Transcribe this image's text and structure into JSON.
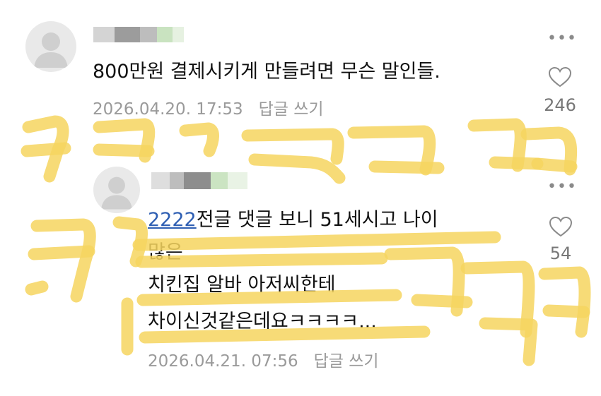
{
  "comments": [
    {
      "text": "800만원 결제시키게 만들려면 무슨 말인들.",
      "date": "2026.04.20. 17:53",
      "reply_label": "답글 쓰기",
      "likes": "246",
      "more": "•••"
    },
    {
      "mention": "2222",
      "lines": [
        "전글 댓글 보니 51세시고 나이",
        "많은",
        "치킨집 알바 아저씨한테",
        "차이신것같은데요ㅋㅋㅋㅋ..."
      ],
      "date": "2026.04.21. 07:56",
      "reply_label": "답글 쓰기",
      "likes": "54",
      "more": "•••"
    }
  ],
  "icons": {
    "avatar": "default-user-icon",
    "like": "heart-outline-icon",
    "more": "more-horizontal-icon"
  },
  "colors": {
    "mention": "#2f5fb3",
    "meta_text": "#9a9a9a",
    "scribble": "#f6d55f"
  }
}
